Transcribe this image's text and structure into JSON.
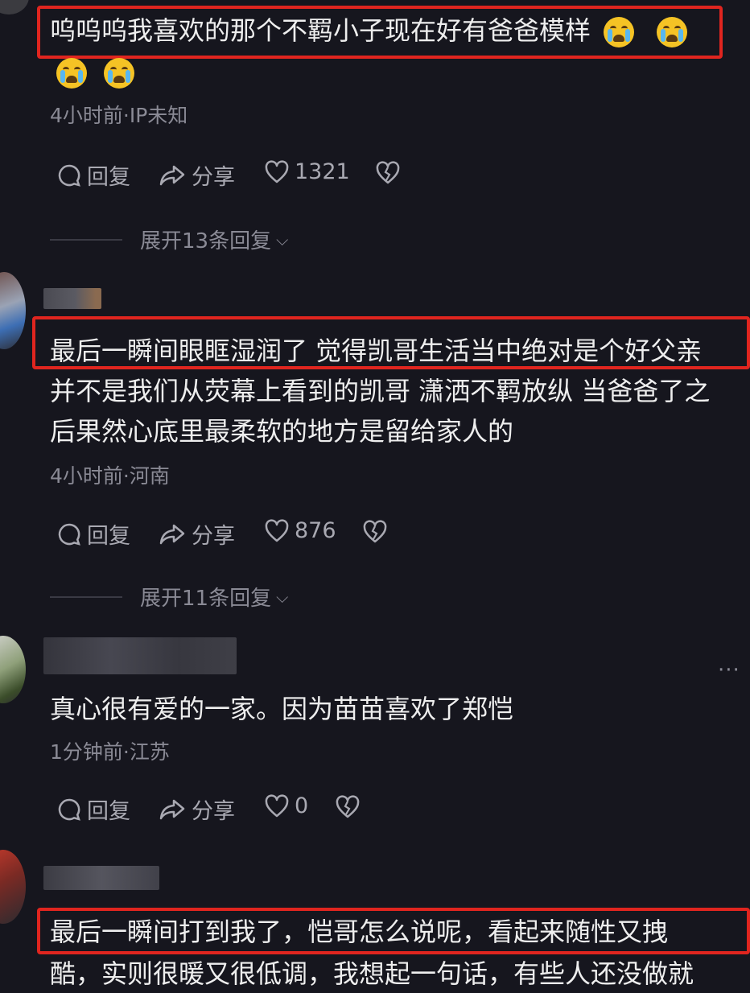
{
  "comments": [
    {
      "text_lines": [
        "呜呜呜我喜欢的那个不羁小子现在好有爸爸模样"
      ],
      "meta": "4小时前·IP未知",
      "reply_label": "回复",
      "share_label": "分享",
      "likes": "1321",
      "expand": "展开13条回复"
    },
    {
      "text_lines": [
        "最后一瞬间眼眶湿润了 觉得凯哥生活当中绝对是个好父亲",
        "并不是我们从荧幕上看到的凯哥 潇洒不羁放纵 当爸爸了之",
        "后果然心底里最柔软的地方是留给家人的"
      ],
      "meta": "4小时前·河南",
      "reply_label": "回复",
      "share_label": "分享",
      "likes": "876",
      "expand": "展开11条回复"
    },
    {
      "text_lines": [
        "真心很有爱的一家。因为苗苗喜欢了郑恺"
      ],
      "meta": "1分钟前·江苏",
      "reply_label": "回复",
      "share_label": "分享",
      "likes": "0"
    },
    {
      "text_lines": [
        "最后一瞬间打到我了，恺哥怎么说呢，看起来随性又拽",
        "酷，实则很暖又很低调，我想起一句话，有些人还没做就"
      ]
    }
  ],
  "more_icon": "more-dots-icon",
  "highlight_color": "#e0251f"
}
